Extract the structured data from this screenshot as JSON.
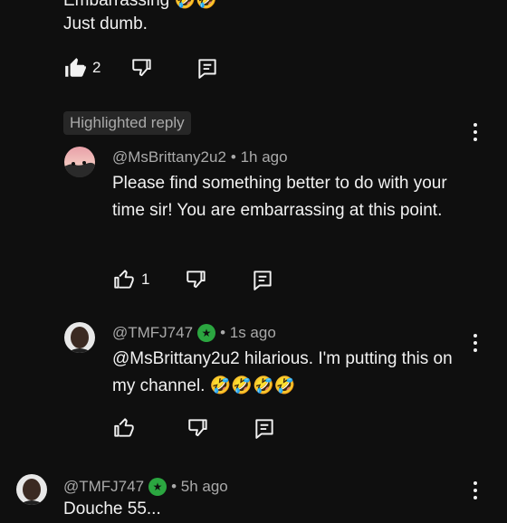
{
  "top_comment": {
    "line1": "Embarrassing 🤣🤣",
    "line2": "Just dumb.",
    "like_count": "2"
  },
  "highlighted_chip": "Highlighted reply",
  "reply1": {
    "handle": "@MsBrittany2u2",
    "time": "• 1h ago",
    "text": "Please find something better to do with your time sir! You are embarrassing at this point.",
    "like_count": "1"
  },
  "reply2": {
    "handle": "@TMFJ747",
    "time": "• 1s ago",
    "text": "@MsBrittany2u2  hilarious. I'm putting this on my channel. 🤣🤣🤣🤣"
  },
  "comment3": {
    "handle": "@TMFJ747",
    "time": "• 5h ago",
    "text": "Douche 55..."
  },
  "icons": [
    "thumb-up-icon",
    "thumb-down-icon",
    "reply-icon",
    "more-vert-icon",
    "verified-icon"
  ],
  "colors": {
    "background": "#0f0f0f",
    "text": "#f1f1f1",
    "muted": "#aaaaaa",
    "chip": "#272727",
    "verified": "#2ba640"
  }
}
